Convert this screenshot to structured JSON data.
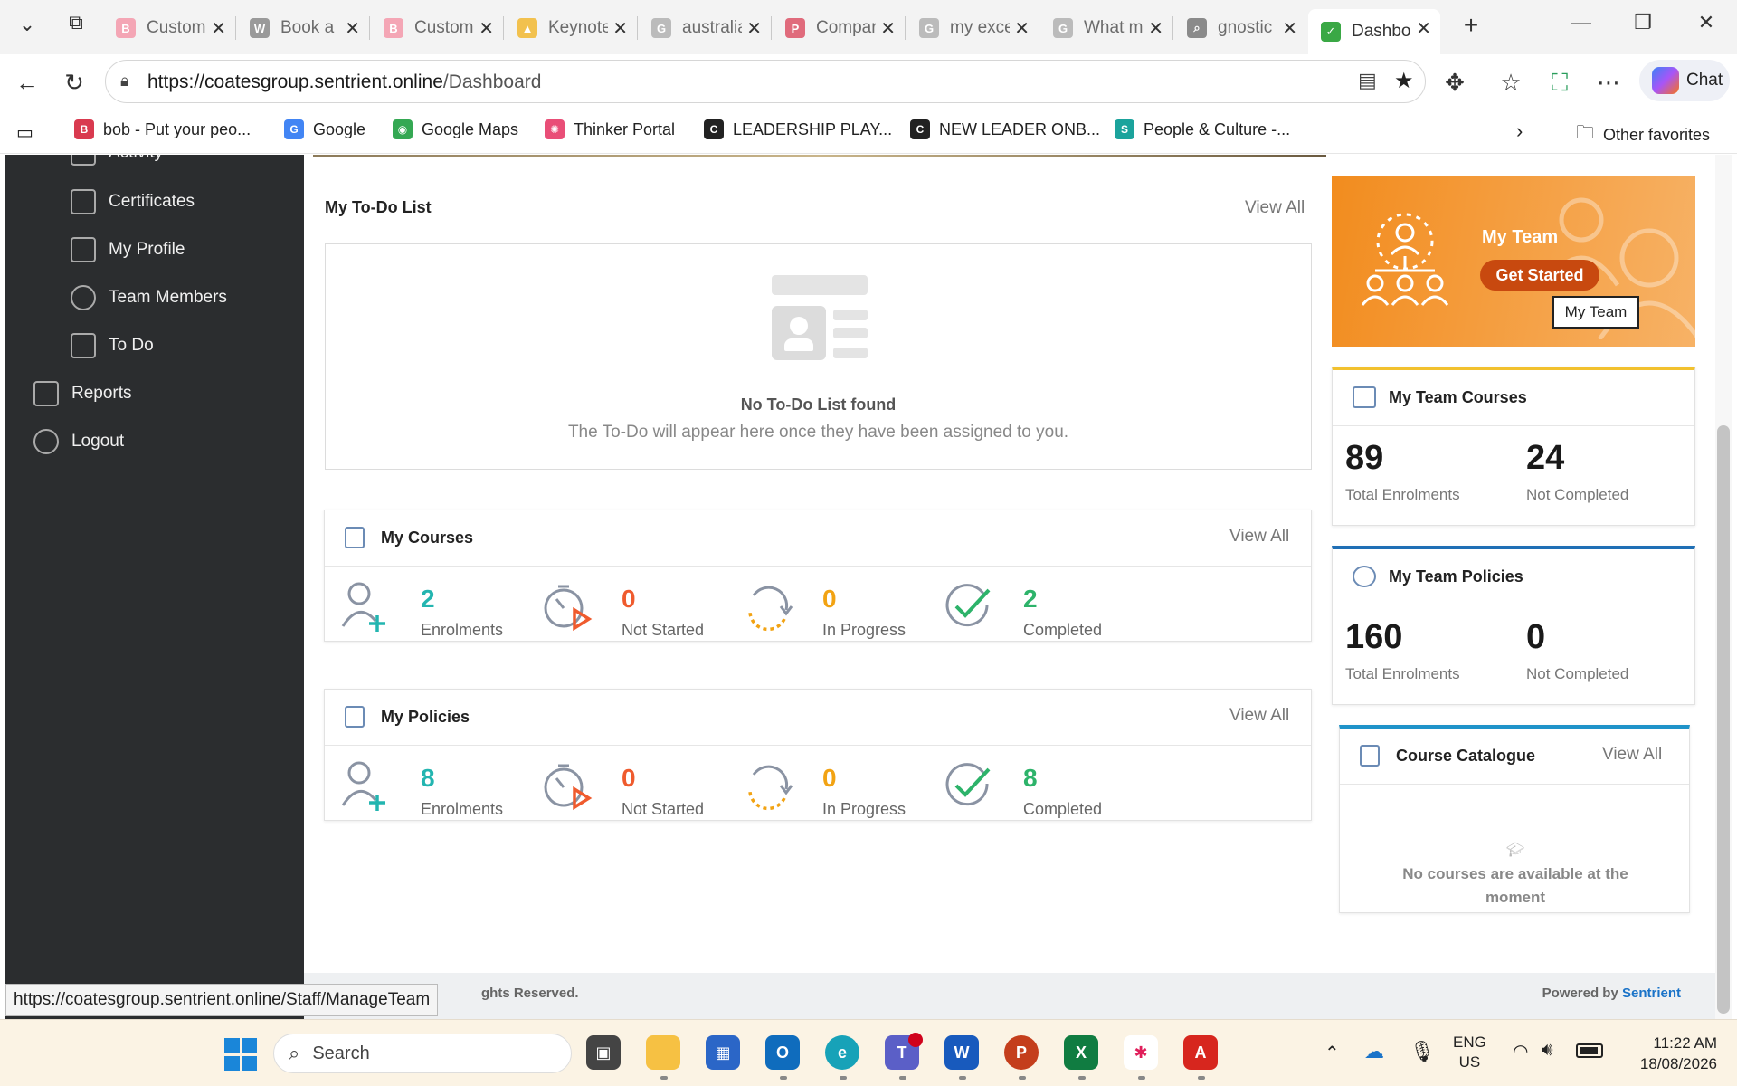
{
  "browser": {
    "tabs": [
      {
        "title": "Custom",
        "favicon": "B",
        "color": "#f4a6b5"
      },
      {
        "title": "Book a",
        "favicon": "W",
        "color": "#9a9a9a"
      },
      {
        "title": "Custom",
        "favicon": "B",
        "color": "#f4a6b5"
      },
      {
        "title": "Keynote",
        "favicon": "▲",
        "color": "#f2c14e"
      },
      {
        "title": "australia",
        "favicon": "G",
        "color": "#bbbbbb"
      },
      {
        "title": "Compar",
        "favicon": "P",
        "color": "#e06b7c"
      },
      {
        "title": "my exce",
        "favicon": "G",
        "color": "#bbbbbb"
      },
      {
        "title": "What m",
        "favicon": "G",
        "color": "#bbbbbb"
      },
      {
        "title": "gnostic",
        "favicon": "⌕",
        "color": "#8a8a8a"
      },
      {
        "title": "Dashbo",
        "favicon": "✓",
        "color": "#3aa845"
      }
    ],
    "url_host": "https://coatesgroup.sentrient.online",
    "url_path": "/Dashboard",
    "chat_label": "Chat",
    "favorites": [
      {
        "label": "bob - Put your peo...",
        "icon": "B",
        "color": "#d93a4f"
      },
      {
        "label": "Google",
        "icon": "G",
        "color": "#4285f4"
      },
      {
        "label": "Google Maps",
        "icon": "◉",
        "color": "#34a853"
      },
      {
        "label": "Thinker Portal",
        "icon": "✺",
        "color": "#e94e77"
      },
      {
        "label": "LEADERSHIP PLAY...",
        "icon": "C",
        "color": "#222222"
      },
      {
        "label": "NEW LEADER ONB...",
        "icon": "C",
        "color": "#222222"
      },
      {
        "label": "People & Culture -...",
        "icon": "S",
        "color": "#1ba39c"
      }
    ],
    "other_favorites": "Other favorites",
    "status_url": "https://coatesgroup.sentrient.online/Staff/ManageTeam"
  },
  "sidebar": {
    "items": [
      {
        "label": "Activity"
      },
      {
        "label": "Certificates"
      },
      {
        "label": "My Profile"
      },
      {
        "label": "Team Members"
      },
      {
        "label": "To Do"
      },
      {
        "label": "Reports"
      },
      {
        "label": "Logout"
      }
    ]
  },
  "todo": {
    "title": "My To-Do List",
    "view_all": "View All",
    "empty_title": "No To-Do List found",
    "empty_text": "The To-Do will appear here once they have been assigned to you."
  },
  "my_courses": {
    "title": "My Courses",
    "view_all": "View All",
    "stats": [
      {
        "value": "2",
        "label": "Enrolments",
        "color": "#23b5b0"
      },
      {
        "value": "0",
        "label": "Not Started",
        "color": "#ef5b2e"
      },
      {
        "value": "0",
        "label": "In Progress",
        "color": "#f2a313"
      },
      {
        "value": "2",
        "label": "Completed",
        "color": "#2db36a"
      }
    ]
  },
  "my_policies": {
    "title": "My Policies",
    "view_all": "View All",
    "stats": [
      {
        "value": "8",
        "label": "Enrolments",
        "color": "#23b5b0"
      },
      {
        "value": "0",
        "label": "Not Started",
        "color": "#ef5b2e"
      },
      {
        "value": "0",
        "label": "In Progress",
        "color": "#f2a313"
      },
      {
        "value": "8",
        "label": "Completed",
        "color": "#2db36a"
      }
    ]
  },
  "my_team": {
    "title": "My Team",
    "button": "Get Started",
    "tooltip": "My Team"
  },
  "team_courses": {
    "title": "My Team Courses",
    "total": "89",
    "total_label": "Total Enrolments",
    "not_completed": "24",
    "not_completed_label": "Not Completed"
  },
  "team_policies": {
    "title": "My Team Policies",
    "total": "160",
    "total_label": "Total Enrolments",
    "not_completed": "0",
    "not_completed_label": "Not Completed"
  },
  "catalogue": {
    "title": "Course Catalogue",
    "view_all": "View All",
    "empty_text": "No courses are available at the moment"
  },
  "footer": {
    "rights": "ghts Reserved.",
    "powered_by": "Powered by",
    "brand": "Sentrient"
  },
  "taskbar": {
    "search_placeholder": "Search",
    "lang": "ENG",
    "region": "US",
    "time": "11:22 AM",
    "date": "18/08/2026"
  },
  "colors": {
    "accent_orange": "#f29a2e",
    "teal": "#23b5b0",
    "sidebar": "#2b2d2f",
    "link_blue": "#1a73c8"
  }
}
